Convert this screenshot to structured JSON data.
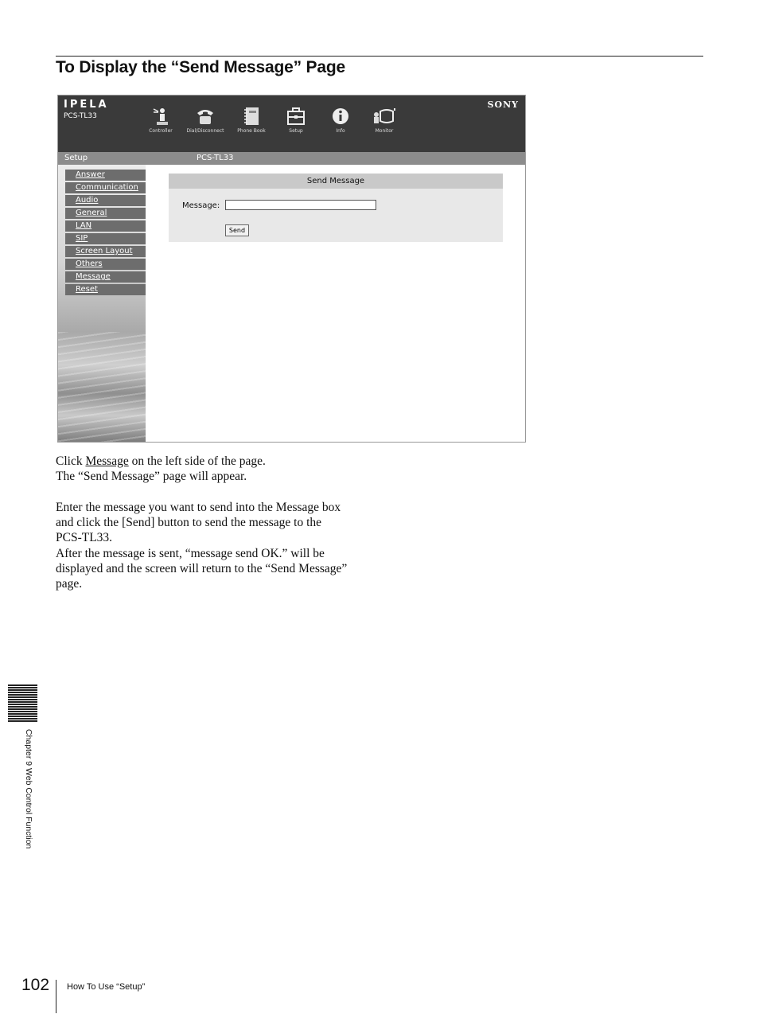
{
  "section": {
    "title": "To Display the “Send Message” Page"
  },
  "screenshot": {
    "brand": "IPELA",
    "model": "PCS-TL33",
    "maker": "SONY",
    "nav": [
      {
        "label": "Controller",
        "icon": "controller-icon"
      },
      {
        "label": "Dial/Disconnect",
        "icon": "phone-icon"
      },
      {
        "label": "Phone Book",
        "icon": "phone-book-icon"
      },
      {
        "label": "Setup",
        "icon": "toolbox-icon"
      },
      {
        "label": "Info",
        "icon": "info-icon"
      },
      {
        "label": "Monitor",
        "icon": "monitor-icon"
      }
    ],
    "band": {
      "left": "Setup",
      "center": "PCS-TL33"
    },
    "menu": [
      "Answer",
      "Communication",
      "Audio",
      "General",
      "LAN",
      "SIP",
      "Screen Layout",
      "Others",
      "Message",
      "Reset"
    ],
    "panel": {
      "title": "Send Message",
      "message_label": "Message:",
      "message_value": "",
      "send_label": "Send"
    }
  },
  "body": {
    "p1_prefix": "Click ",
    "p1_link": "Message",
    "p1_suffix": " on the left side of the page.",
    "p2": "The “Send Message” page will appear.",
    "p3_line1": "Enter the message you want to send into the Message box",
    "p3_line2": "and click the [Send] button to send the message to the",
    "p3_line3": "PCS-TL33.",
    "p4_line1": "After the message is sent, “message send OK.” will be",
    "p4_line2": "displayed and the screen will return to the “Send Message”",
    "p4_line3": "page."
  },
  "sidebar_chapter": "Chapter 9  Web Control Function",
  "footer": {
    "page_number": "102",
    "section": "How To Use “Setup”"
  }
}
